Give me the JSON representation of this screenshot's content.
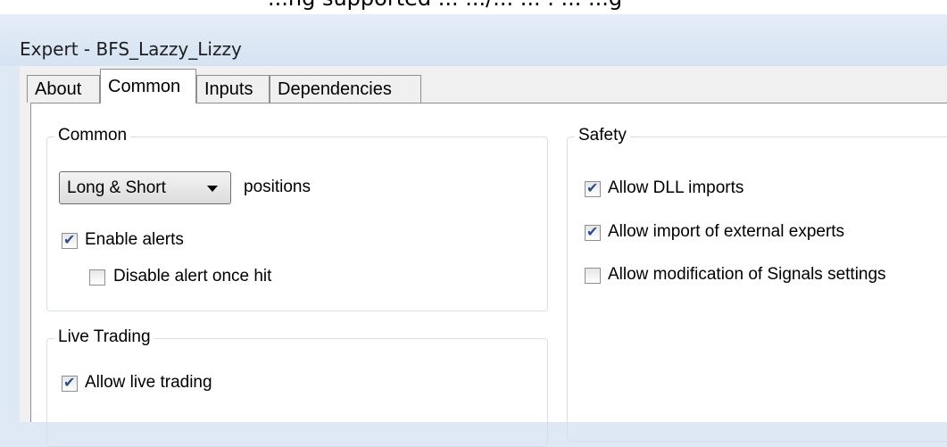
{
  "window": {
    "top_clipped_text": "...ng supported  ...  .../... ... . ... ...g",
    "title": "Expert - BFS_Lazzy_Lizzy"
  },
  "tabs": [
    {
      "label": "About",
      "active": false
    },
    {
      "label": "Common",
      "active": true
    },
    {
      "label": "Inputs",
      "active": false
    },
    {
      "label": "Dependencies",
      "active": false
    }
  ],
  "common_group": {
    "label": "Common",
    "positions_select": {
      "value": "Long & Short"
    },
    "positions_label": "positions",
    "enable_alerts": {
      "label": "Enable alerts",
      "checked": true
    },
    "disable_alert_once_hit": {
      "label": "Disable alert once hit",
      "checked": false
    }
  },
  "live_trading_group": {
    "label": "Live Trading",
    "allow_live_trading": {
      "label": "Allow live trading",
      "checked": true
    }
  },
  "safety_group": {
    "label": "Safety",
    "allow_dll_imports": {
      "label": "Allow DLL imports",
      "checked": true
    },
    "allow_import_external": {
      "label": "Allow import of external experts",
      "checked": true
    },
    "allow_signals_mod": {
      "label": "Allow modification of Signals settings",
      "checked": false
    }
  },
  "colors": {
    "accent": "#2a4d8f",
    "window_bg": "#f0f0f0",
    "titlebar": "#dfe9f5"
  }
}
